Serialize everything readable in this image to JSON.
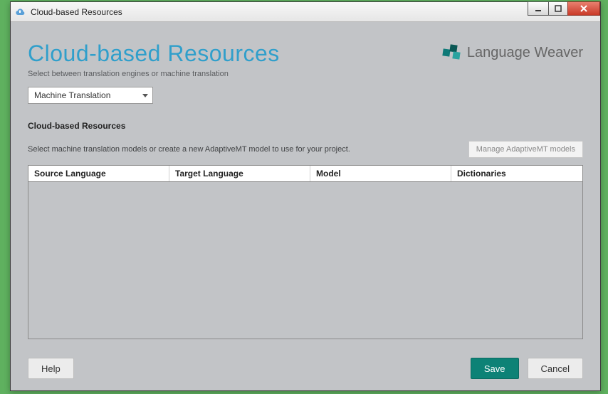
{
  "window": {
    "title": "Cloud-based Resources"
  },
  "header": {
    "page_title": "Cloud-based Resources",
    "subtitle": "Select between translation engines or machine translation",
    "brand": "Language Weaver"
  },
  "dropdown": {
    "selected": "Machine Translation"
  },
  "section": {
    "title": "Cloud-based Resources",
    "description": "Select machine translation models or create a new AdaptiveMT model to use for your project.",
    "manage_label": "Manage AdaptiveMT models"
  },
  "table": {
    "columns": [
      "Source Language",
      "Target Language",
      "Model",
      "Dictionaries"
    ],
    "rows": []
  },
  "footer": {
    "help": "Help",
    "save": "Save",
    "cancel": "Cancel"
  }
}
